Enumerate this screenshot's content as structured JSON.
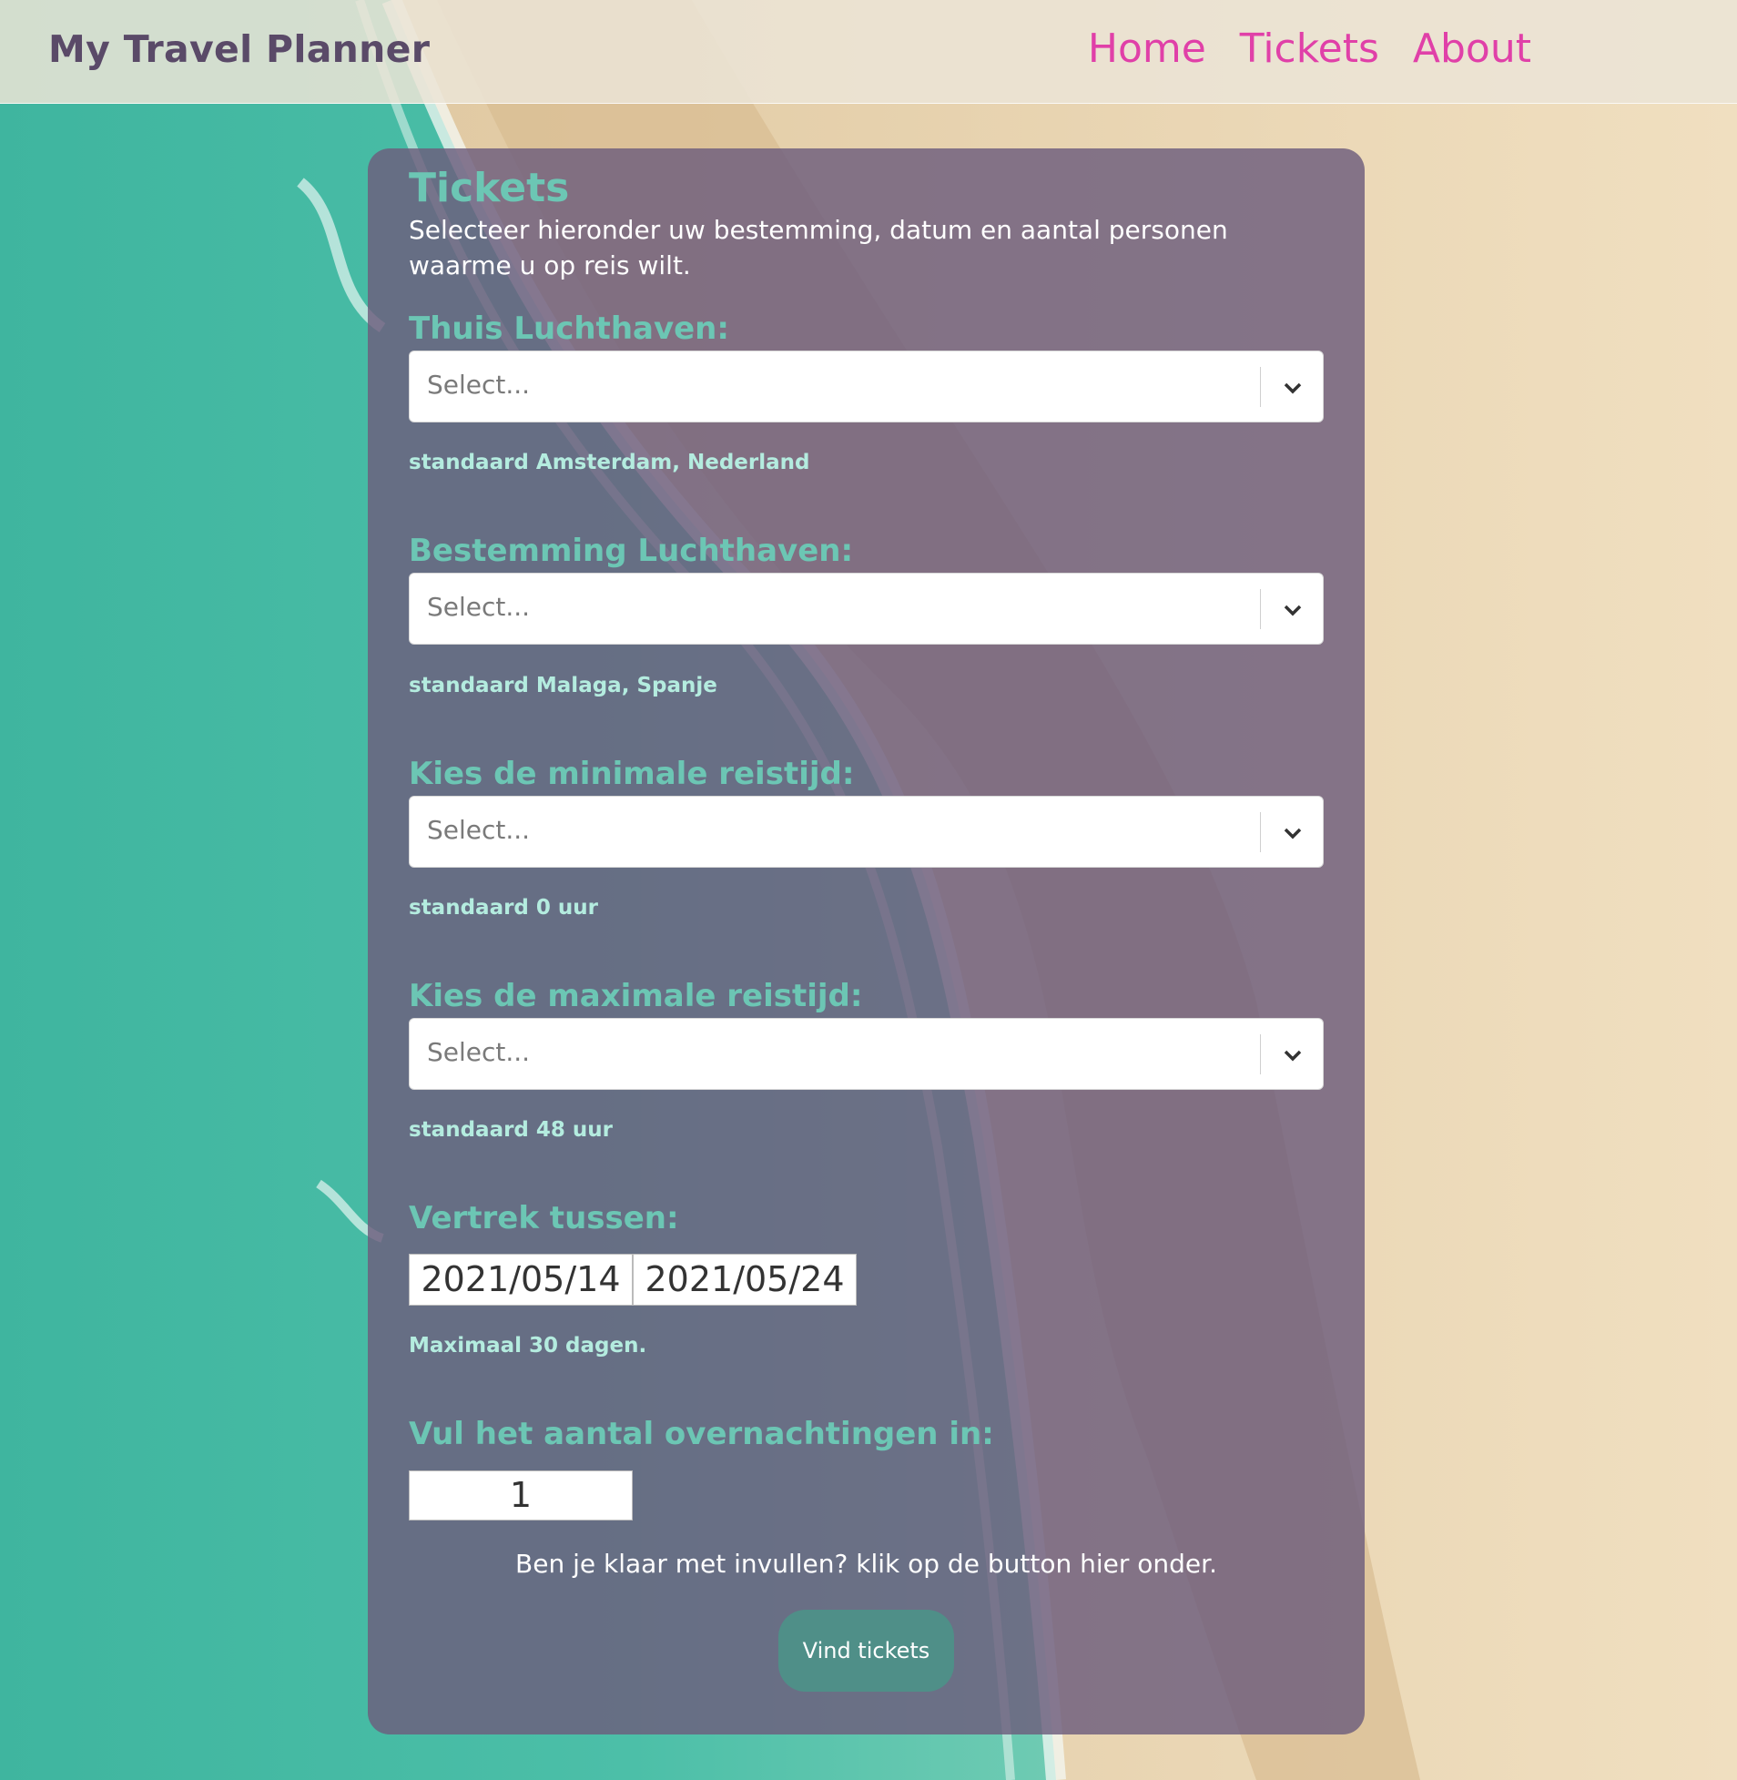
{
  "header": {
    "brand": "My Travel Planner",
    "nav": [
      {
        "label": "Home"
      },
      {
        "label": "Tickets"
      },
      {
        "label": "About"
      }
    ]
  },
  "card": {
    "title": "Tickets",
    "intro": "Selecteer hieronder uw bestemming, datum en aantal personen waarme u op reis wilt.",
    "fields": [
      {
        "label": "Thuis Luchthaven:",
        "placeholder": "Select...",
        "hint": "standaard Amsterdam, Nederland"
      },
      {
        "label": "Bestemming Luchthaven:",
        "placeholder": "Select...",
        "hint": "standaard Malaga, Spanje"
      },
      {
        "label": "Kies de minimale reistijd:",
        "placeholder": "Select...",
        "hint": "standaard 0 uur"
      },
      {
        "label": "Kies de maximale reistijd:",
        "placeholder": "Select...",
        "hint": "standaard 48 uur"
      }
    ],
    "departure": {
      "label": "Vertrek tussen:",
      "from": "2021/05/14",
      "to": "2021/05/24",
      "hint": "Maximaal 30 dagen."
    },
    "nights": {
      "label": "Vul het aantal overnachtingen in:",
      "value": "1"
    },
    "done_text": "Ben je klaar met invullen? klik op de button hier onder.",
    "submit_label": "Vind tickets"
  },
  "colors": {
    "accent": "#6cc6b4",
    "nav": "#e040a8",
    "card": "#6c5d7d",
    "button": "#4f8f88"
  }
}
